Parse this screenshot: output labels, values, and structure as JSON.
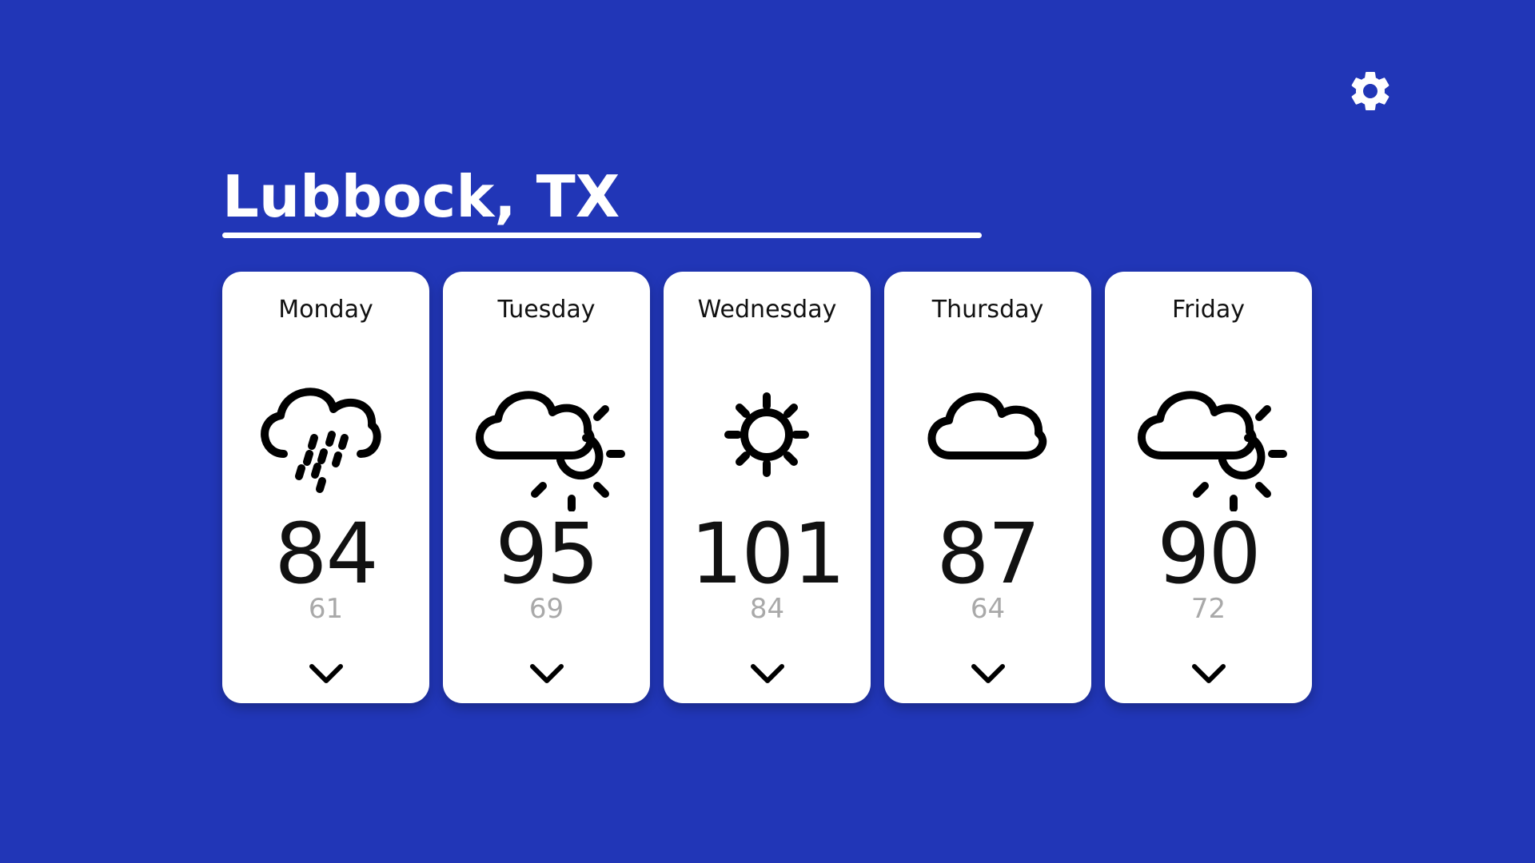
{
  "location": "Lubbock, TX",
  "colors": {
    "background": "#2136b7",
    "card": "#ffffff",
    "text": "#111111",
    "low_temp": "#a9a9a9"
  },
  "settings_icon": "gear-icon",
  "forecast": [
    {
      "day": "Monday",
      "icon": "rain-cloud-icon",
      "high": "84",
      "low": "61"
    },
    {
      "day": "Tuesday",
      "icon": "partly-sunny-icon",
      "high": "95",
      "low": "69"
    },
    {
      "day": "Wednesday",
      "icon": "sun-icon",
      "high": "101",
      "low": "84"
    },
    {
      "day": "Thursday",
      "icon": "cloud-icon",
      "high": "87",
      "low": "64"
    },
    {
      "day": "Friday",
      "icon": "partly-sunny-icon",
      "high": "90",
      "low": "72"
    }
  ]
}
